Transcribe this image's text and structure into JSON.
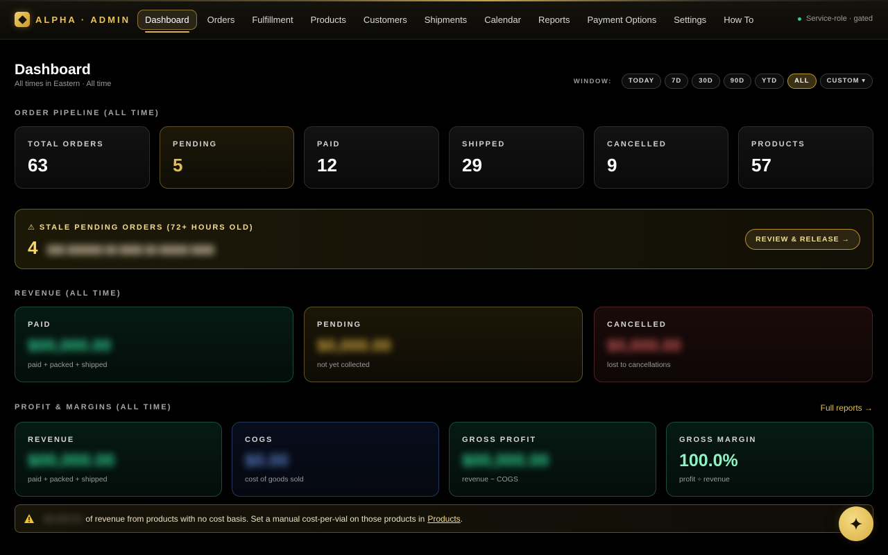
{
  "brand": {
    "name": "ALPHA · ADMIN",
    "logo_icon": "diamond-logo-icon"
  },
  "nav": {
    "items": [
      {
        "label": "Dashboard",
        "active": true
      },
      {
        "label": "Orders"
      },
      {
        "label": "Fulfillment"
      },
      {
        "label": "Products"
      },
      {
        "label": "Customers"
      },
      {
        "label": "Shipments"
      },
      {
        "label": "Calendar"
      },
      {
        "label": "Reports"
      },
      {
        "label": "Payment Options"
      },
      {
        "label": "Settings"
      },
      {
        "label": "How To"
      }
    ],
    "service_status": "Service-role · gated",
    "status_color": "#2fcf8f"
  },
  "header": {
    "title": "Dashboard",
    "subtitle": "All times in Eastern · All time",
    "window_label": "WINDOW:",
    "window_options": [
      "TODAY",
      "7D",
      "30D",
      "90D",
      "YTD",
      "ALL",
      "CUSTOM ▾"
    ],
    "window_selected": "ALL"
  },
  "pipeline": {
    "label": "ORDER PIPELINE (ALL TIME)",
    "cards": [
      {
        "label": "TOTAL ORDERS",
        "value": "63"
      },
      {
        "label": "PENDING",
        "value": "5"
      },
      {
        "label": "PAID",
        "value": "12"
      },
      {
        "label": "SHIPPED",
        "value": "29"
      },
      {
        "label": "CANCELLED",
        "value": "9"
      },
      {
        "label": "PRODUCTS",
        "value": "57"
      }
    ]
  },
  "stale": {
    "title": "⚠ STALE PENDING ORDERS (72+ HOURS OLD)",
    "count": "4",
    "detail_redacted": "",
    "button_label": "REVIEW & RELEASE →"
  },
  "revenue": {
    "label": "REVENUE (ALL TIME)",
    "cards": [
      {
        "label": "PAID",
        "value": "",
        "sub": "paid + packed + shipped"
      },
      {
        "label": "PENDING",
        "value": "",
        "sub": "not yet collected"
      },
      {
        "label": "CANCELLED",
        "value": "",
        "sub": "lost to cancellations"
      }
    ]
  },
  "profit": {
    "label": "PROFIT & MARGINS (ALL TIME)",
    "full_reports_link": "Full reports →",
    "cards": [
      {
        "label": "REVENUE",
        "value": "",
        "sub": "paid + packed + shipped"
      },
      {
        "label": "COGS",
        "value": "",
        "sub": "cost of goods sold"
      },
      {
        "label": "GROSS PROFIT",
        "value": "",
        "sub": "revenue − COGS"
      },
      {
        "label": "GROSS MARGIN",
        "value": "100.0%",
        "sub": "profit ÷ revenue"
      }
    ]
  },
  "warning": {
    "redacted_amount": "",
    "text": "of revenue from products with no cost basis. Set a manual cost-per-vial on those products in",
    "link": "Products",
    "trailing": "."
  },
  "colors": {
    "accent_gold": "#e3bd55",
    "green": "#2fd295",
    "red": "#cf5a57",
    "blue": "#5a7fc8",
    "mint": "#8ef2c4"
  },
  "fab_icon": "sparkle-icon"
}
